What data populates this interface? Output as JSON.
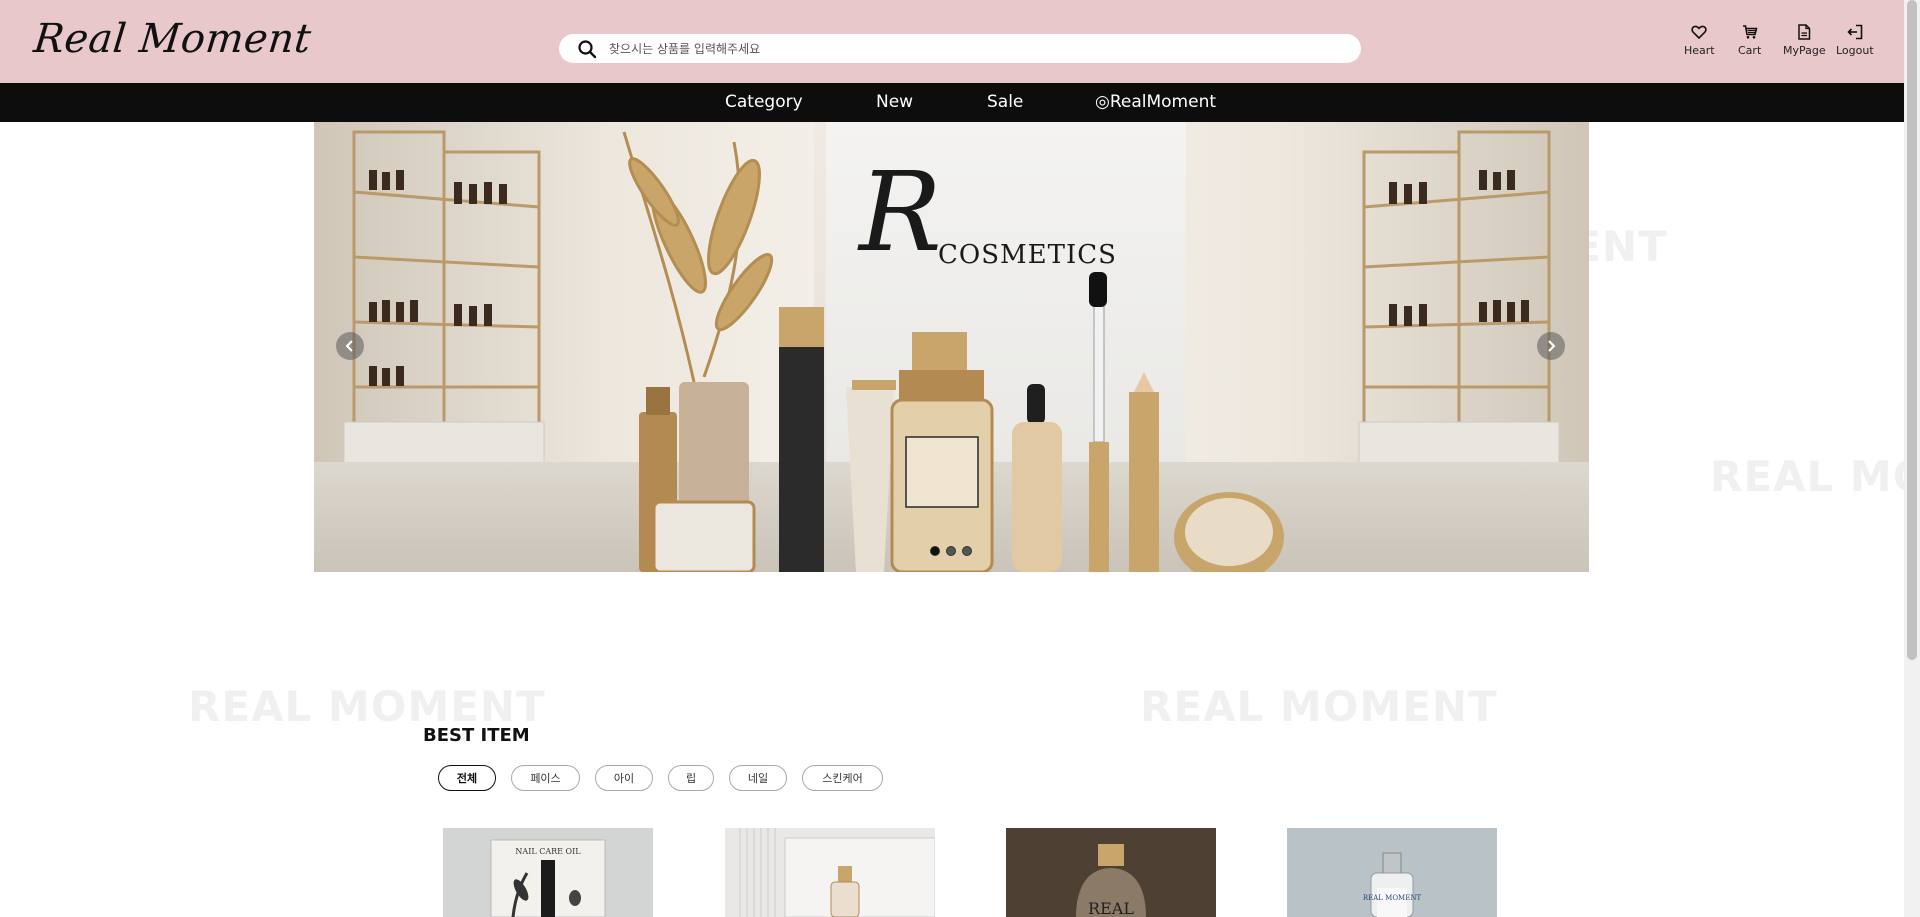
{
  "header": {
    "logo": "Real Moment",
    "search_placeholder": "찾으시는 상품를 입력해주세요",
    "menu": [
      {
        "label": "Heart",
        "icon": "heart-icon"
      },
      {
        "label": "Cart",
        "icon": "cart-icon"
      },
      {
        "label": "MyPage",
        "icon": "document-icon"
      },
      {
        "label": "Logout",
        "icon": "logout-icon"
      }
    ]
  },
  "nav": {
    "items": [
      "Category",
      "New",
      "Sale",
      "◎RealMoment"
    ]
  },
  "watermark": "REAL MOMENT",
  "carousel": {
    "brand_letter": "R",
    "brand_text": "COSMETICS",
    "slide_count": 3,
    "active_slide": 1
  },
  "best": {
    "title": "BEST ITEM",
    "filters": [
      "전체",
      "페이스",
      "아이",
      "립",
      "네일",
      "스킨케어"
    ],
    "active_filter": "전체",
    "products": [
      {
        "name": "nail-care-oil",
        "label": "NAIL CARE OIL",
        "bg": "#d2d5d4"
      },
      {
        "name": "serum-bottle",
        "label": "",
        "bg": "#e9e8e6"
      },
      {
        "name": "gold-bottle",
        "label": "",
        "bg": "#5b4c3d"
      },
      {
        "name": "real-moment-bottle",
        "label": "REAL MOMENT",
        "bg": "#b9c2c6"
      }
    ]
  },
  "colors": {
    "header_bg": "#e8c8ca",
    "nav_bg": "#0d0d0d",
    "accent_gold": "#c8a56a"
  }
}
